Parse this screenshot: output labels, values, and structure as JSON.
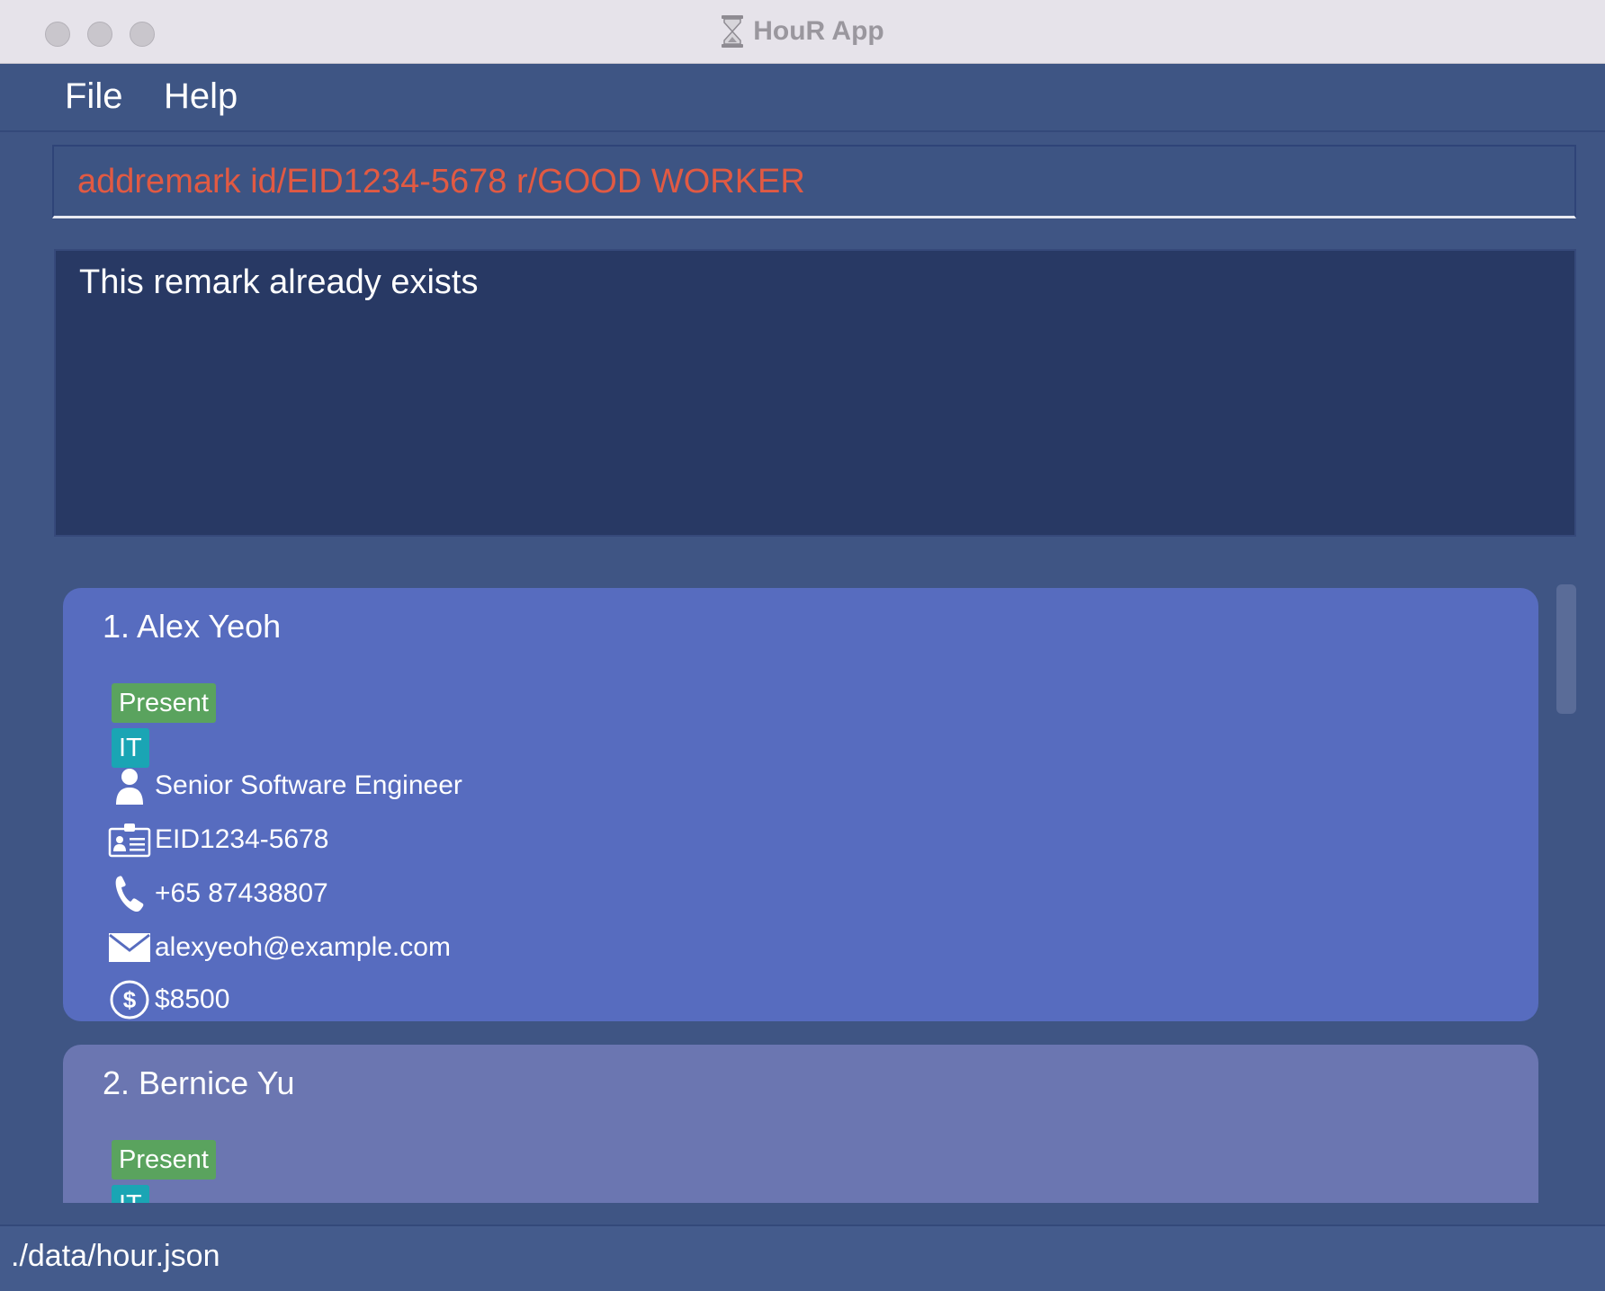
{
  "window": {
    "title": "HouR App",
    "colors": {
      "background": "#3f5584",
      "command_text": "#e15a43",
      "result_bg": "#283964",
      "card_selected": "#576cbf",
      "card_normal": "#6b76b1",
      "status_badge": "#5aa35e",
      "department_badge": "#1aa5b4"
    }
  },
  "menu": {
    "file": "File",
    "help": "Help"
  },
  "command": {
    "value": "addremark id/EID1234-5678 r/GOOD WORKER"
  },
  "result": {
    "message": "This remark already exists"
  },
  "people": [
    {
      "index_name": "1.  Alex Yeoh",
      "status": "Present",
      "department": "IT",
      "role": "Senior Software Engineer",
      "employee_id": "EID1234-5678",
      "phone": "+65 87438807",
      "email": "alexyeoh@example.com",
      "salary": "$8500",
      "icons": {
        "role": "person-icon",
        "id": "id-card-icon",
        "phone": "phone-icon",
        "email": "envelope-icon",
        "salary": "dollar-icon"
      }
    },
    {
      "index_name": "2.  Bernice Yu",
      "status": "Present",
      "department": "IT"
    }
  ],
  "statusbar": {
    "path": "./data/hour.json"
  }
}
